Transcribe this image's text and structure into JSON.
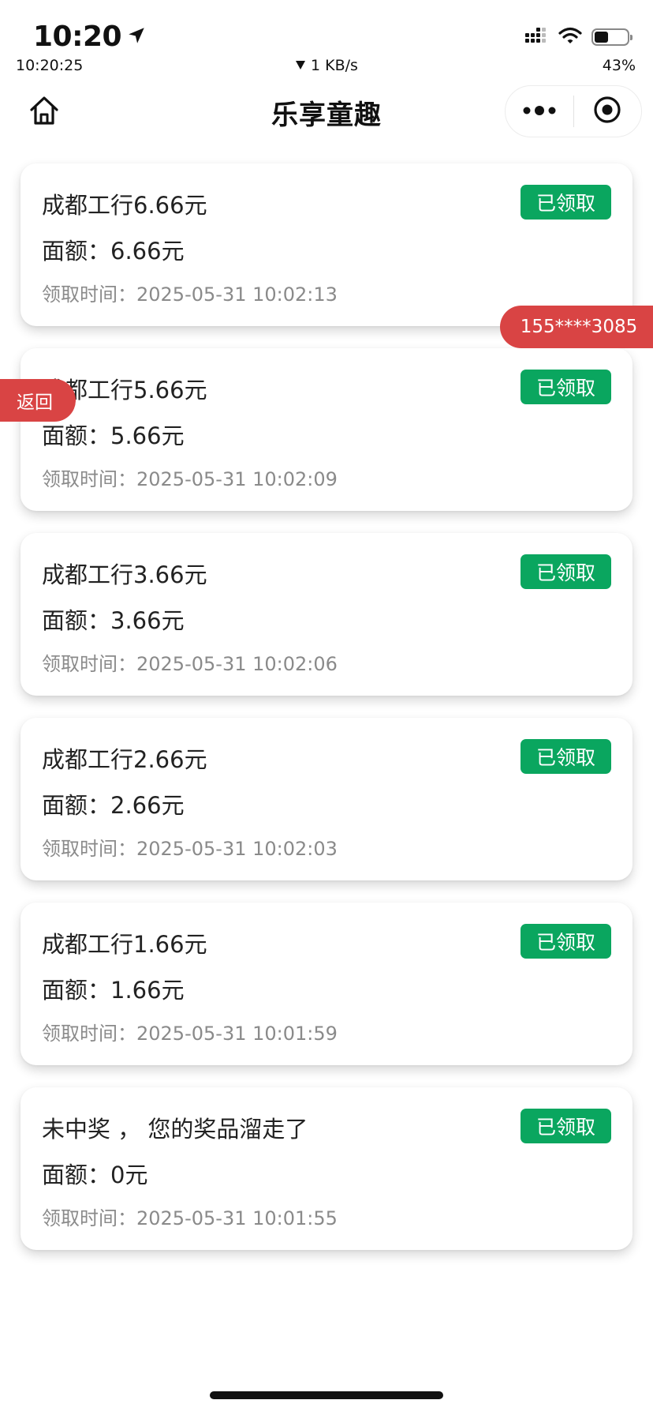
{
  "status_bar": {
    "time": "10:20",
    "sub_time": "10:20:25",
    "network_speed": "1 KB/s",
    "battery_percent": "43%",
    "battery_level": 0.43
  },
  "nav": {
    "title": "乐享童趣"
  },
  "records": [
    {
      "title": "成都工行6.66元",
      "amount_label": "面额：",
      "amount": "6.66元",
      "time_label": "领取时间：",
      "time": "2025-05-31 10:02:13",
      "status": "已领取"
    },
    {
      "title": "成都工行5.66元",
      "amount_label": "面额：",
      "amount": "5.66元",
      "time_label": "领取时间：",
      "time": "2025-05-31 10:02:09",
      "status": "已领取"
    },
    {
      "title": "成都工行3.66元",
      "amount_label": "面额：",
      "amount": "3.66元",
      "time_label": "领取时间：",
      "time": "2025-05-31 10:02:06",
      "status": "已领取"
    },
    {
      "title": "成都工行2.66元",
      "amount_label": "面额：",
      "amount": "2.66元",
      "time_label": "领取时间：",
      "time": "2025-05-31 10:02:03",
      "status": "已领取"
    },
    {
      "title": "成都工行1.66元",
      "amount_label": "面额：",
      "amount": "1.66元",
      "time_label": "领取时间：",
      "time": "2025-05-31 10:01:59",
      "status": "已领取"
    },
    {
      "title": "未中奖 ， 您的奖品溜走了",
      "amount_label": "面额：",
      "amount": "0元",
      "time_label": "领取时间：",
      "time": "2025-05-31 10:01:55",
      "status": "已领取"
    }
  ],
  "floating": {
    "phone": "155****3085",
    "back_label": "返回"
  },
  "colors": {
    "badge_green": "#0aa65f",
    "tag_red": "#d94444"
  }
}
